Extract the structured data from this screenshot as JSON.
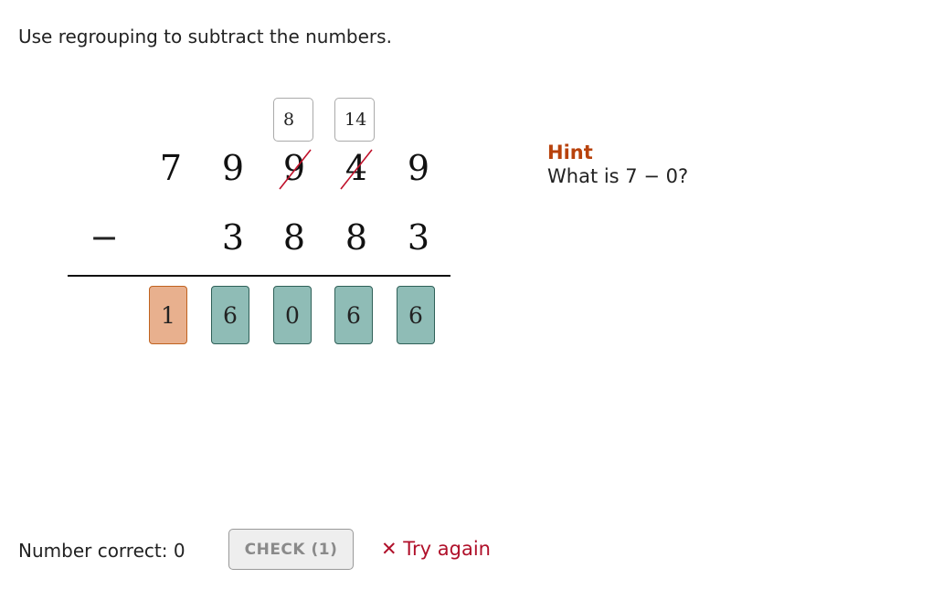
{
  "instructions": "Use regrouping to subtract the numbers.",
  "problem": {
    "minuend_digits": [
      "7",
      "9",
      "9",
      "4",
      "9"
    ],
    "subtrahend_digits": [
      "3",
      "8",
      "8",
      "3"
    ],
    "operator": "−",
    "crossed_out_columns": [
      2,
      3
    ],
    "carry_inputs": [
      {
        "column": 2,
        "value": "8"
      },
      {
        "column": 3,
        "value": "14"
      }
    ],
    "answer_digits": [
      {
        "value": "1",
        "status": "incorrect"
      },
      {
        "value": "6",
        "status": "correct"
      },
      {
        "value": "0",
        "status": "correct"
      },
      {
        "value": "6",
        "status": "correct"
      },
      {
        "value": "6",
        "status": "correct"
      }
    ]
  },
  "hint": {
    "title": "Hint",
    "text": "What is 7 − 0?"
  },
  "footer": {
    "number_correct_label": "Number correct: 0",
    "check_button_label": "CHECK (1)",
    "feedback_icon": "x-icon",
    "feedback_text": "✕ Try again"
  },
  "colors": {
    "hint_title": "#b8420c",
    "incorrect_fill": "#e8b08e",
    "correct_fill": "#8fbcb6",
    "feedback": "#b0102a",
    "strike": "#c0102a"
  }
}
